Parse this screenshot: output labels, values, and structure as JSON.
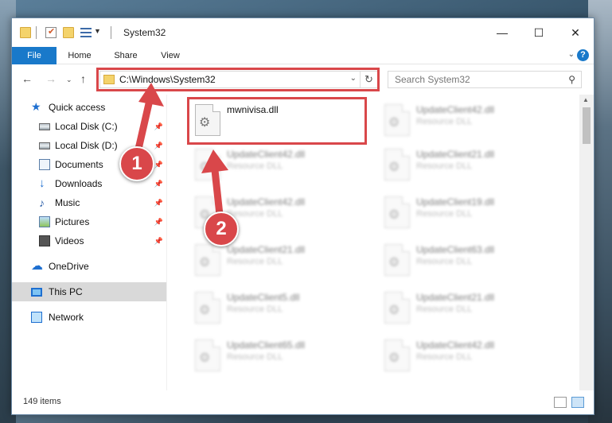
{
  "window": {
    "title": "System32"
  },
  "ribbon": {
    "tabs": [
      "File",
      "Home",
      "Share",
      "View"
    ],
    "help": "?"
  },
  "nav": {
    "address": "C:\\Windows\\System32",
    "search_placeholder": "Search System32"
  },
  "sidebar": {
    "items": [
      {
        "label": "Quick access",
        "icon": "star-icon",
        "pinned": false
      },
      {
        "label": "Local Disk (C:)",
        "icon": "disk-icon",
        "pinned": true
      },
      {
        "label": "Local Disk (D:)",
        "icon": "disk-icon",
        "pinned": true
      },
      {
        "label": "Documents",
        "icon": "documents-icon",
        "pinned": true
      },
      {
        "label": "Downloads",
        "icon": "download-icon",
        "pinned": true
      },
      {
        "label": "Music",
        "icon": "music-icon",
        "pinned": true
      },
      {
        "label": "Pictures",
        "icon": "pictures-icon",
        "pinned": true
      },
      {
        "label": "Videos",
        "icon": "videos-icon",
        "pinned": true
      },
      {
        "label": "OneDrive",
        "icon": "cloud-icon",
        "pinned": false
      },
      {
        "label": "This PC",
        "icon": "pc-icon",
        "pinned": false,
        "selected": true
      },
      {
        "label": "Network",
        "icon": "network-icon",
        "pinned": false
      }
    ]
  },
  "files": {
    "highlight": {
      "name": "mwnivisa.dll"
    },
    "left": [
      {
        "name": "UpdateClient42.dll",
        "type": "Resource DLL"
      },
      {
        "name": "UpdateClient42.dll",
        "type": "Resource DLL"
      },
      {
        "name": "UpdateClient21.dll",
        "type": "Resource DLL"
      },
      {
        "name": "UpdateClient5.dll",
        "type": "Resource DLL"
      },
      {
        "name": "UpdateClient65.dll",
        "type": "Resource DLL"
      }
    ],
    "right": [
      {
        "name": "UpdateClient42.dll",
        "type": "Resource DLL"
      },
      {
        "name": "UpdateClient21.dll",
        "type": "Resource DLL"
      },
      {
        "name": "UpdateClient19.dll",
        "type": "Resource DLL"
      },
      {
        "name": "UpdateClient63.dll",
        "type": "Resource DLL"
      },
      {
        "name": "UpdateClient21.dll",
        "type": "Resource DLL"
      },
      {
        "name": "UpdateClient42.dll",
        "type": "Resource DLL"
      }
    ]
  },
  "status": {
    "items_count": "149 items"
  },
  "callouts": [
    "1",
    "2"
  ],
  "colors": {
    "accent": "#1979ca",
    "highlight_red": "#d9474a"
  }
}
